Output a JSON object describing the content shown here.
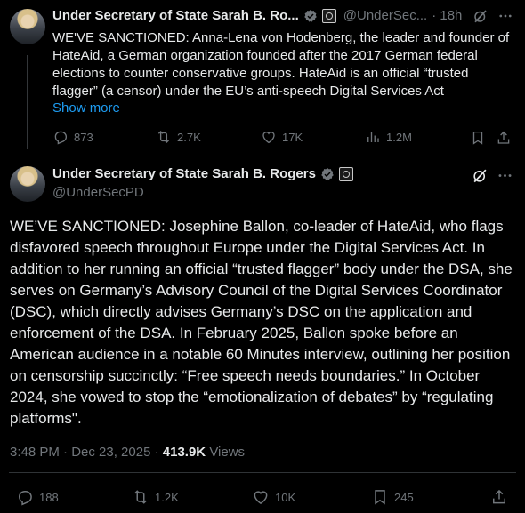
{
  "post1": {
    "author_name": "Under Secretary of State Sarah B. Ro...",
    "handle": "@UnderSec...",
    "time": "· 18h",
    "text": "WE'VE SANCTIONED: Anna-Lena von Hodenberg, the leader and founder of HateAid, a German organization founded after the 2017 German federal elections to counter conservative groups. HateAid is an official “trusted flagger” (a censor) under the EU’s anti-speech Digital Services Act",
    "show_more": "Show more",
    "replies": "873",
    "reposts": "2.7K",
    "likes": "17K",
    "views": "1.2M"
  },
  "post2": {
    "author_name": "Under Secretary of State Sarah B. Rogers",
    "handle": "@UnderSecPD",
    "text": "WE’VE SANCTIONED: Josephine Ballon, co-leader of HateAid, who flags disfavored speech throughout Europe under the Digital Services Act. In addition to her running an official “trusted flagger” body under the DSA, she serves on Germany’s Advisory Council of the Digital Services Coordinator (DSC), which directly advises Germany’s DSC on the application and enforcement of the DSA. In February 2025, Ballon spoke before an American audience in a notable 60 Minutes interview, outlining her position on censorship succinctly: “Free speech needs boundaries.” In October 2024, she vowed to stop the “emotionalization of debates” by “regulating platforms\".",
    "timestamp": "3:48 PM · Dec 23, 2025 ·",
    "views_count": "413.9K",
    "views_label": "Views",
    "replies": "188",
    "reposts": "1.2K",
    "likes": "10K",
    "bookmarks": "245"
  },
  "colors": {
    "background": "#000000",
    "text": "#e7e9ea",
    "muted": "#71767b",
    "link": "#1d9bf0",
    "verified": "#1d9bf0"
  }
}
